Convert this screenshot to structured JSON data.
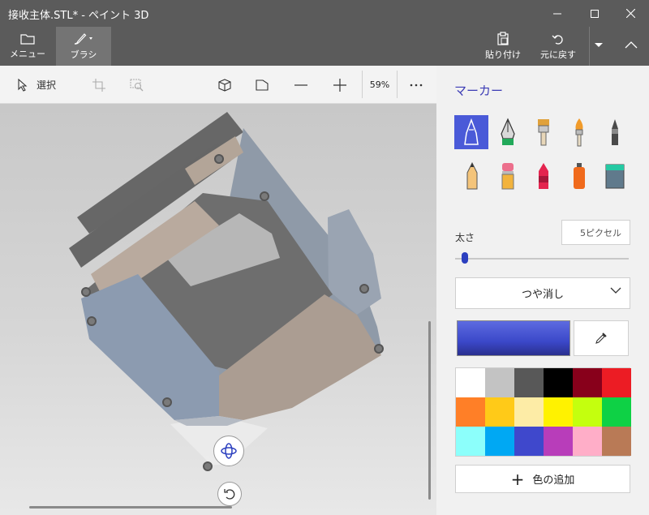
{
  "window": {
    "title": "接收主体.STL* - ペイント 3D"
  },
  "ribbon": {
    "menu_label": "メニュー",
    "brush_label": "ブラシ",
    "paste_label": "貼り付け",
    "undo_label": "元に戻す"
  },
  "toolbar": {
    "select_label": "選択",
    "zoom_value": "59%"
  },
  "panel": {
    "title": "マーカー",
    "tools": [
      "marker-icon",
      "calligraphy-pen-icon",
      "oil-brush-icon",
      "watercolor-icon",
      "pixel-pen-icon",
      "pencil-icon",
      "eraser-icon",
      "crayon-icon",
      "spray-can-icon",
      "fill-bucket-icon"
    ],
    "thickness_label": "太さ",
    "thickness_value": "5ピクセル",
    "finish_value": "つや消し",
    "current_color": "#3b48c9",
    "palette": [
      "#ffffff",
      "#c3c3c3",
      "#585858",
      "#000000",
      "#88001b",
      "#ec1c24",
      "#ff7f27",
      "#ffca18",
      "#fdeca6",
      "#fff200",
      "#c4ff0e",
      "#0ed145",
      "#8cfffb",
      "#00a8f3",
      "#3f48cc",
      "#b83dba",
      "#ffaec8",
      "#b97a56"
    ],
    "add_color_label": "色の追加"
  }
}
